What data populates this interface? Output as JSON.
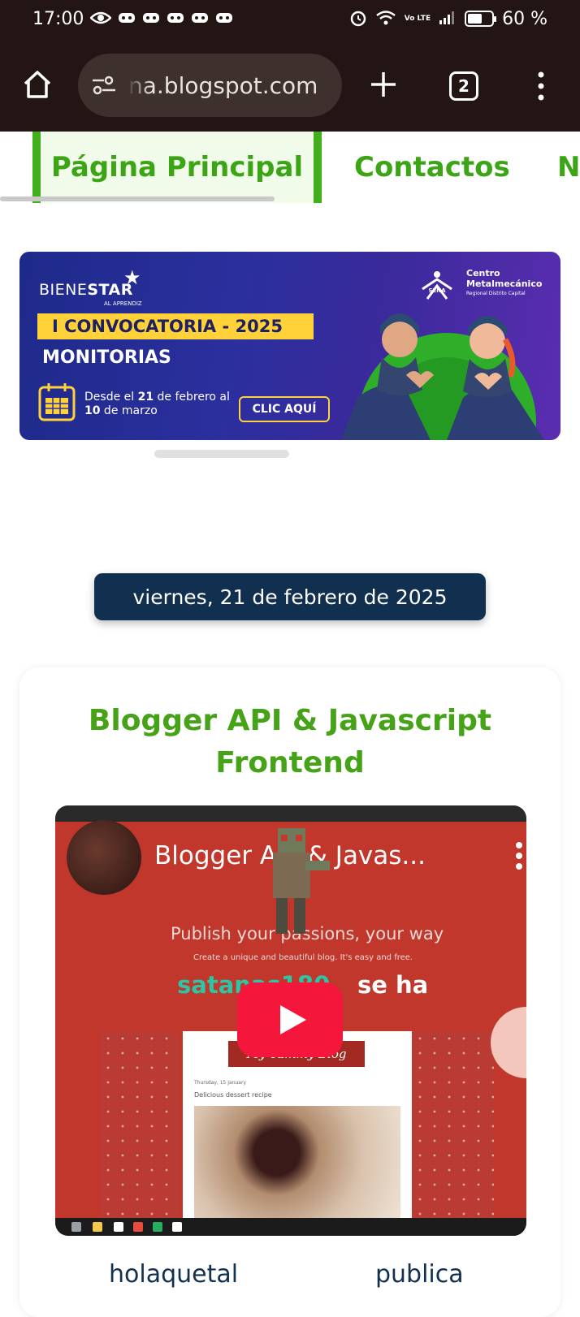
{
  "status_bar": {
    "time": "17:00",
    "network": "Vo LTE",
    "battery_percent": "60 %",
    "battery_level": 0.6
  },
  "browser": {
    "url": "na.blogspot.com",
    "tab_count": "2"
  },
  "site_nav": {
    "items": [
      {
        "label": "Página Principal",
        "active": true
      },
      {
        "label": "Contactos",
        "active": false
      },
      {
        "label": "N",
        "active": false
      }
    ]
  },
  "banner": {
    "brand_light": "BIENE",
    "brand_bold": "STAR",
    "brand_sub": "AL APRENDIZ",
    "convocatoria": "I CONVOCATORIA - 2025",
    "monitorias": "MONITORIAS",
    "date_line1_a": "Desde el ",
    "date_line1_b": "21",
    "date_line1_c": " de febrero al",
    "date_line2_a": "10",
    "date_line2_b": " de marzo",
    "cta": "CLIC AQUÍ",
    "sena": "SENA",
    "centro": "Centro",
    "metalmecanico": "Metalmecánico",
    "regional": "Regional Distrito Capital"
  },
  "post": {
    "date": "viernes, 21 de febrero de 2025",
    "title": "Blogger API & Javascript Frontend",
    "video": {
      "title": "Blogger API & Javas...",
      "publish_line": "Publish your passions, your way",
      "create_line": "Create a unique and beautiful blog. It's easy and free.",
      "user_text": "satanas180",
      "action_text": "se ha",
      "blog_ribbon": "My Yummy Blog",
      "blog_date": "Thursday, 15 January",
      "blog_post": "Delicious dessert recipe"
    },
    "tags": [
      "holaquetal",
      "publica"
    ]
  },
  "colors": {
    "chrome_bg": "#221513",
    "nav_green": "#3ca515",
    "title_green": "#46a318",
    "date_pill": "#11304f",
    "youtube_red": "#f5163b"
  }
}
